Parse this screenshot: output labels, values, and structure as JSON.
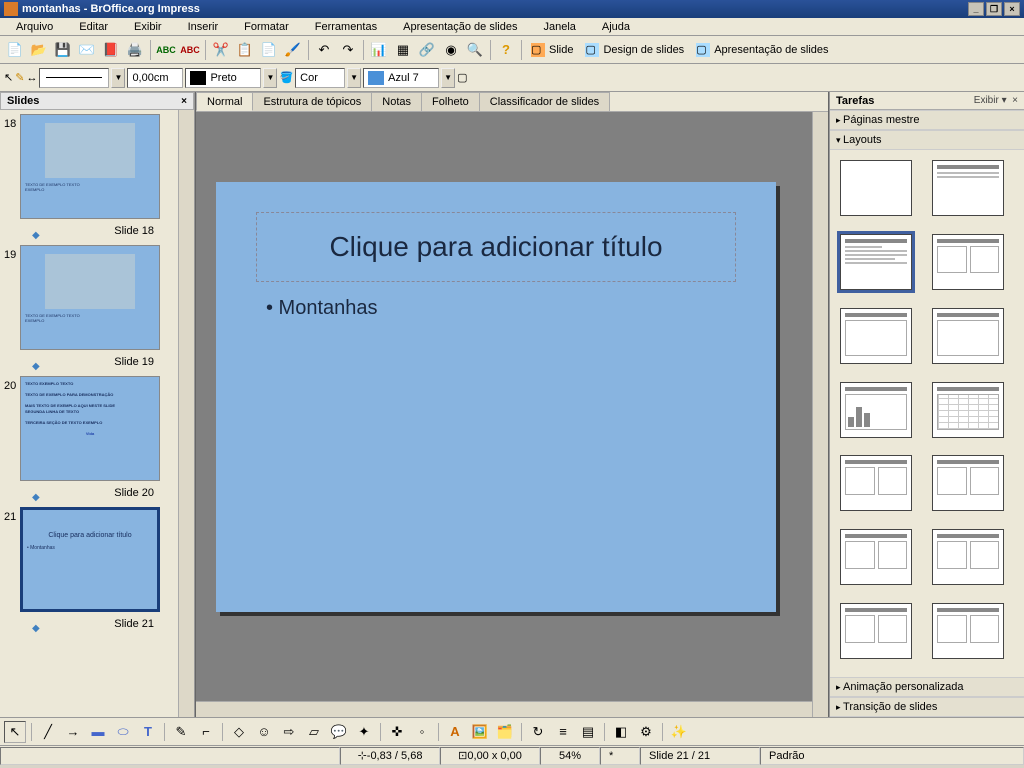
{
  "title": "montanhas - BrOffice.org Impress",
  "menu": [
    "Arquivo",
    "Editar",
    "Exibir",
    "Inserir",
    "Formatar",
    "Ferramentas",
    "Apresentação de slides",
    "Janela",
    "Ajuda"
  ],
  "toolbar_right": {
    "slide": "Slide",
    "design": "Design de slides",
    "present": "Apresentação de slides"
  },
  "toolbar2": {
    "width": "0,00cm",
    "color1": "Preto",
    "fill_label": "Cor",
    "color2": "Azul 7"
  },
  "slides_panel": {
    "title": "Slides"
  },
  "thumbs": [
    {
      "num": "18",
      "label": "Slide 18",
      "has_img": true
    },
    {
      "num": "19",
      "label": "Slide 19",
      "has_img": true
    },
    {
      "num": "20",
      "label": "Slide 20",
      "has_img": false
    },
    {
      "num": "21",
      "label": "Slide 21",
      "has_img": false,
      "selected": true,
      "mini_title": "Clique para adicionar título"
    }
  ],
  "tabs": [
    "Normal",
    "Estrutura de tópicos",
    "Notas",
    "Folheto",
    "Classificador de slides"
  ],
  "active_tab": 0,
  "slide": {
    "title_placeholder": "Clique para adicionar título",
    "bullet": "• Montanhas"
  },
  "tasks": {
    "title": "Tarefas",
    "view": "Exibir",
    "sections": [
      "Páginas mestre",
      "Layouts",
      "Animação personalizada",
      "Transição de slides"
    ]
  },
  "status": {
    "pos": "-0,83 / 5,68",
    "size": "0,00 x 0,00",
    "zoom": "54%",
    "slide": "Slide 21 / 21",
    "style": "Padrão"
  }
}
